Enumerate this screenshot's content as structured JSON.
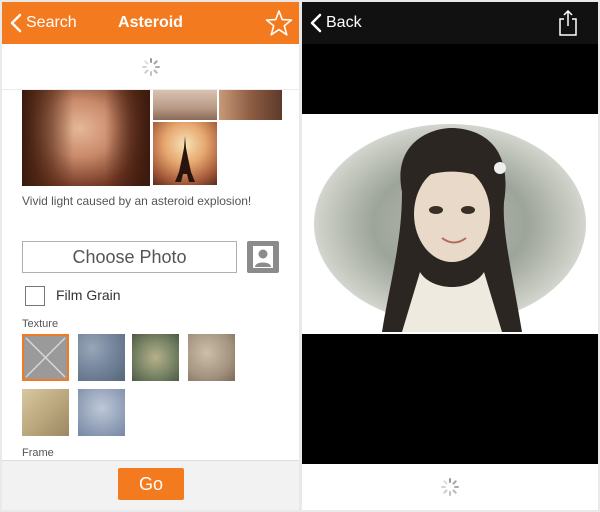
{
  "left_screen": {
    "navbar": {
      "back_label": "Search",
      "title": "Asteroid",
      "star_icon": "star-outline-icon",
      "color": "#f47a20"
    },
    "description": "Vivid light caused by an asteroid explosion!",
    "choose_photo_label": "Choose Photo",
    "contact_icon": "person-icon",
    "film_grain_label": "Film Grain",
    "film_grain_checked": false,
    "texture_label": "Texture",
    "frame_label": "Frame",
    "go_label": "Go"
  },
  "right_screen": {
    "navbar": {
      "back_label": "Back",
      "share_icon": "share-icon",
      "color": "#111111"
    }
  }
}
